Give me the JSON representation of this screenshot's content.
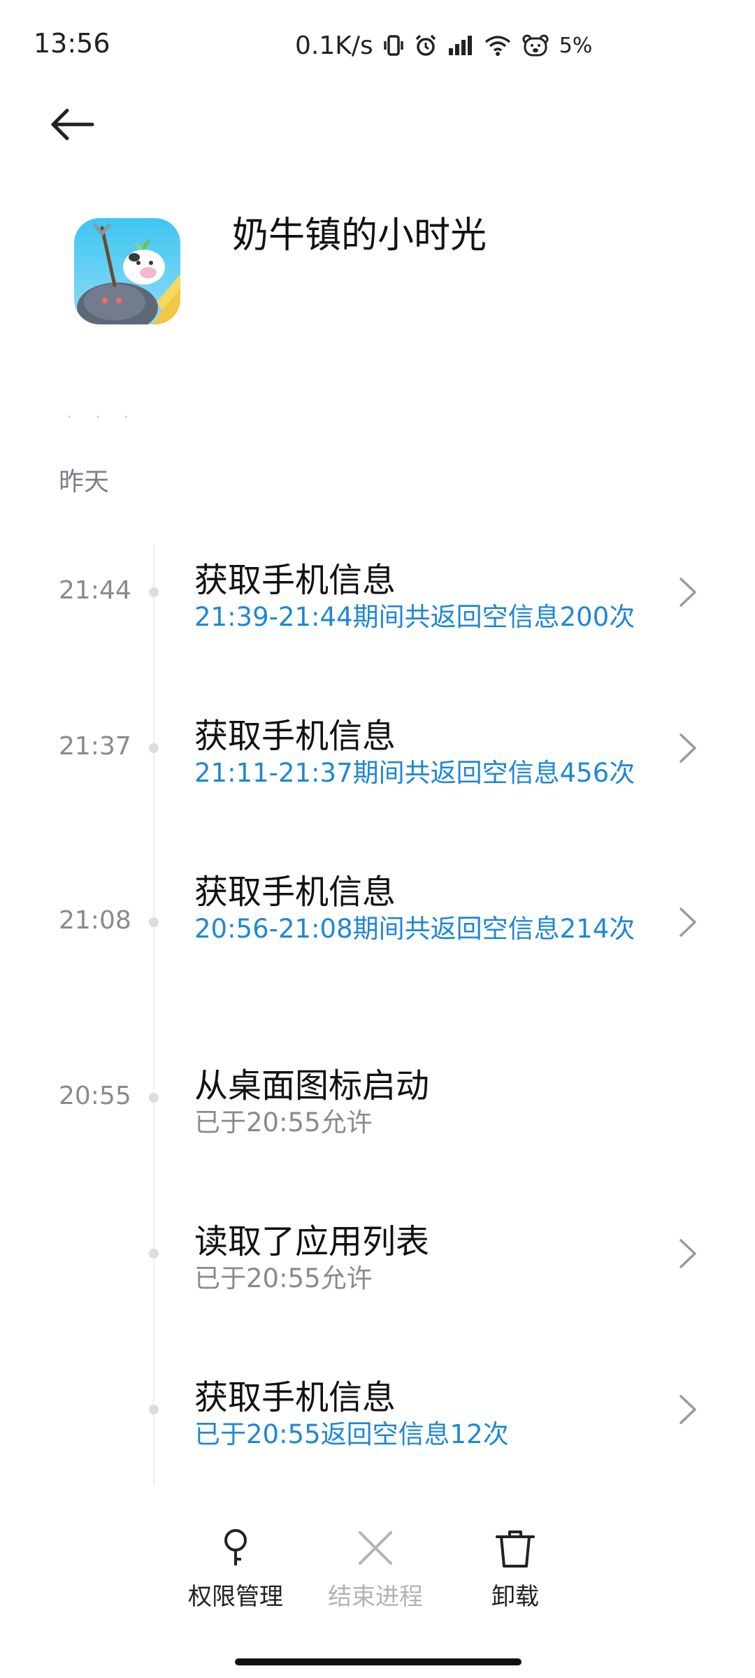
{
  "status_bar": {
    "time": "13:56",
    "speed": "0.1K/s",
    "battery": "5%",
    "icons": [
      "vibrate-icon",
      "alarm-icon",
      "signal-icon",
      "wifi-icon",
      "bear-icon"
    ]
  },
  "header": {
    "back_icon": "arrow-left-icon",
    "app_name": "奶牛镇的小时光"
  },
  "timeline": {
    "more_indicator": "· · ·",
    "section_label": "昨天",
    "events": [
      {
        "time": "21:44",
        "title": "获取手机信息",
        "subtitle": "21:39-21:44期间共返回空信息200次",
        "subtitle_color": "blue",
        "has_chevron": true
      },
      {
        "time": "21:37",
        "title": "获取手机信息",
        "subtitle": "21:11-21:37期间共返回空信息456次",
        "subtitle_color": "blue",
        "has_chevron": true
      },
      {
        "time": "21:08",
        "title": "获取手机信息",
        "subtitle": "20:56-21:08期间共返回空信息214次",
        "subtitle_color": "blue",
        "has_chevron": true
      },
      {
        "time": "20:55",
        "title": "从桌面图标启动",
        "subtitle": "已于20:55允许",
        "subtitle_color": "gray",
        "has_chevron": false
      },
      {
        "time": "",
        "title": "读取了应用列表",
        "subtitle": "已于20:55允许",
        "subtitle_color": "gray",
        "has_chevron": true
      },
      {
        "time": "",
        "title": "获取手机信息",
        "subtitle": "已于20:55返回空信息12次",
        "subtitle_color": "blue",
        "has_chevron": true
      }
    ]
  },
  "bottom_actions": {
    "permissions": {
      "label": "权限管理",
      "icon": "key-icon",
      "enabled": true
    },
    "end_process": {
      "label": "结束进程",
      "icon": "close-icon",
      "enabled": false
    },
    "uninstall": {
      "label": "卸载",
      "icon": "trash-icon",
      "enabled": true
    }
  },
  "colors": {
    "accent_blue": "#1f87d6",
    "secondary_gray": "#8a8a8a",
    "section_label": "#7d7d88",
    "disabled_label": "#b3b3b3"
  }
}
